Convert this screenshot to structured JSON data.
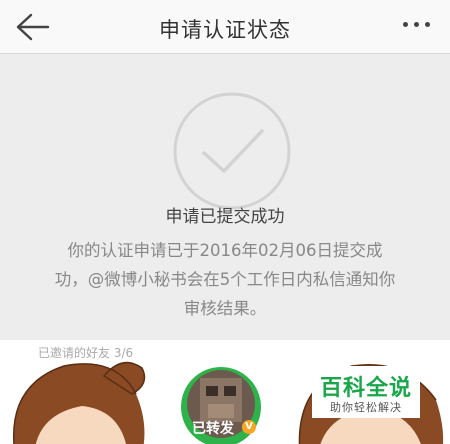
{
  "header": {
    "title": "申请认证状态",
    "back_icon": "arrow-left-icon",
    "more_icon": "more-dots-icon"
  },
  "status": {
    "icon": "check-circle-icon",
    "title": "申请已提交成功",
    "description_lines": [
      "你的认证申请已于2016年02月06日提交成",
      "功，@微博小秘书会在5个工作日内私信通知你",
      "审核结果。"
    ]
  },
  "invite": {
    "label": "已邀请的好友 3/6",
    "repost_label": "已转发",
    "verified_badge": "V"
  },
  "watermark": {
    "title": "百科全说",
    "subtitle": "助你轻松解决"
  },
  "colors": {
    "header_bg": "#f9f9f9",
    "page_bg": "#ededed",
    "accent_green": "#19a74a",
    "badge_orange": "#f5a623"
  }
}
